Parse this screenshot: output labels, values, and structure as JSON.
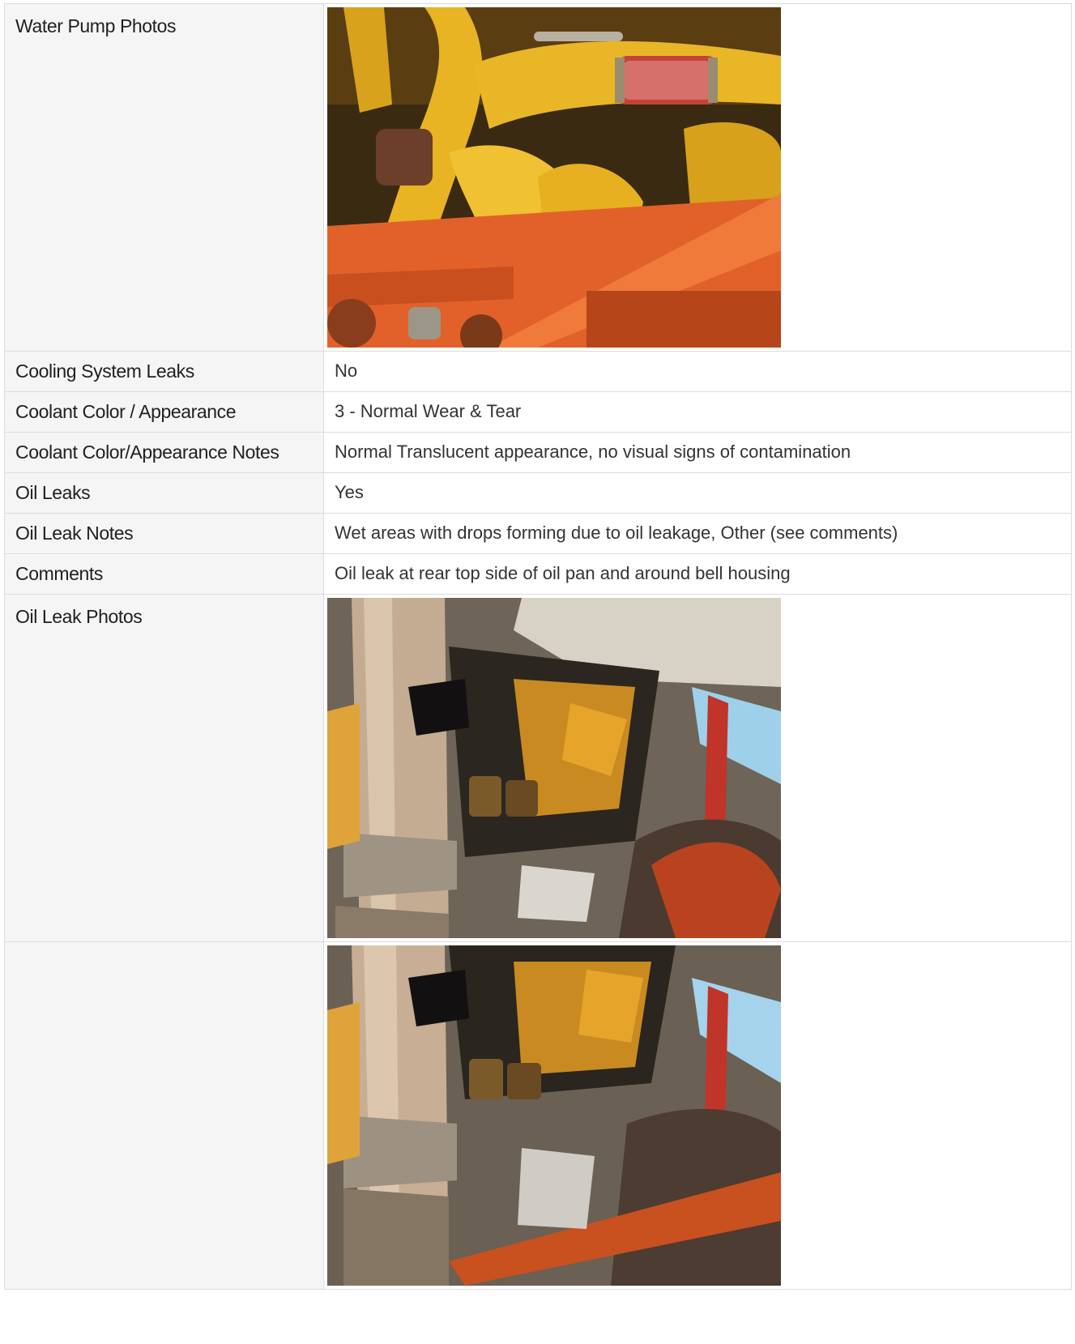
{
  "rows": [
    {
      "label": "Water Pump Photos",
      "type": "photos",
      "photos": [
        "engine-bay-photo"
      ]
    },
    {
      "label": "Cooling System Leaks",
      "value": "No"
    },
    {
      "label": "Coolant Color / Appearance",
      "value": "3 - Normal Wear & Tear"
    },
    {
      "label": "Coolant Color/Appearance Notes",
      "value": "Normal Translucent appearance, no visual signs of contamination"
    },
    {
      "label": "Oil Leaks",
      "value": "Yes"
    },
    {
      "label": "Oil Leak Notes",
      "value": "Wet areas with drops forming due to oil leakage, Other (see comments)"
    },
    {
      "label": "Comments",
      "value": "Oil leak at rear top side of oil pan and around bell housing"
    },
    {
      "label": "Oil Leak Photos",
      "type": "photos",
      "photos": [
        "oil-pan-photo-1"
      ]
    },
    {
      "label": "",
      "type": "photos",
      "photos": [
        "oil-pan-photo-2"
      ]
    }
  ],
  "colors": {
    "label_bg": "#f5f5f5",
    "border": "#dcdcdc",
    "engine_yellow": "#e6b21f",
    "frame_orange": "#e2612a"
  }
}
